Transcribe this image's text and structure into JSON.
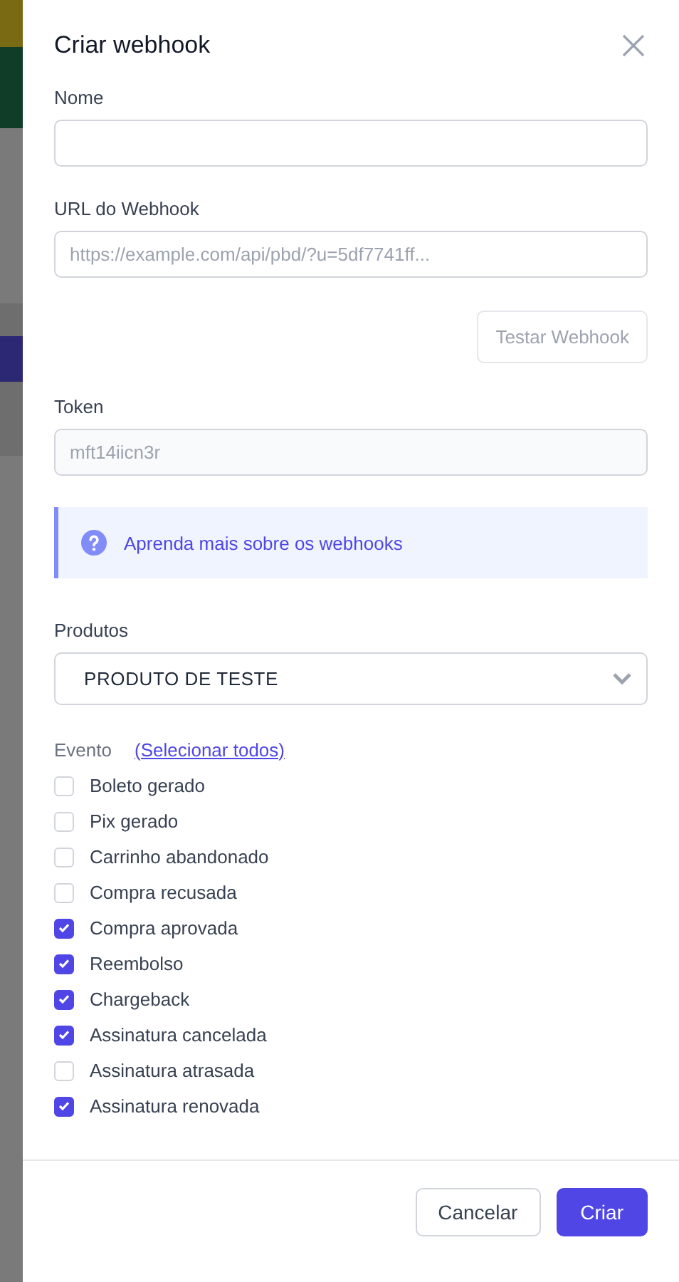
{
  "dialog": {
    "title": "Criar webhook",
    "fields": [
      {
        "label": "Nome",
        "kind": "input"
      },
      {
        "label": "URL do Webhook",
        "kind": "input",
        "placeholder": "https://example.com/api/pbd/?u=5df7741ff..."
      },
      {
        "label": "Token",
        "kind": "readonly",
        "value": "mft14iicn3r"
      }
    ],
    "test_button": "Testar Webhook",
    "info": "Aprenda mais sobre os webhooks",
    "products": {
      "label": "Produtos",
      "value": "PRODUTO DE TESTE"
    },
    "events": {
      "label": "Evento",
      "select_all": "(Selecionar todos)",
      "items": [
        {
          "label": "Boleto gerado",
          "checked": false
        },
        {
          "label": "Pix gerado",
          "checked": false
        },
        {
          "label": "Carrinho abandonado",
          "checked": false
        },
        {
          "label": "Compra recusada",
          "checked": false
        },
        {
          "label": "Compra aprovada",
          "checked": true
        },
        {
          "label": "Reembolso",
          "checked": true
        },
        {
          "label": "Chargeback",
          "checked": true
        },
        {
          "label": "Assinatura cancelada",
          "checked": true
        },
        {
          "label": "Assinatura atrasada",
          "checked": false
        },
        {
          "label": "Assinatura renovada",
          "checked": true
        }
      ]
    },
    "buttons": [
      {
        "label": "Cancelar",
        "kind": "secondary"
      },
      {
        "label": "Criar",
        "kind": "primary"
      }
    ]
  }
}
